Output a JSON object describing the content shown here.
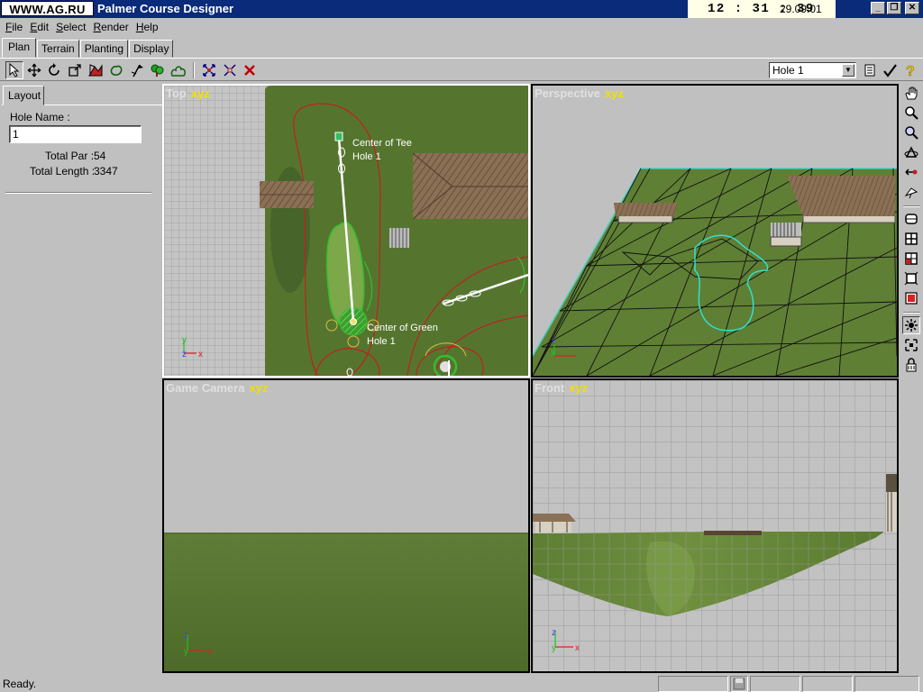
{
  "title_bar": {
    "logo": "WWW.AG.RU",
    "app_title": "Palmer Course Designer",
    "clock_time": "12 : 31 : 39",
    "clock_date": "29.09.01",
    "minimize": "_",
    "maximize": "❐",
    "close": "✕"
  },
  "menu": [
    "File",
    "Edit",
    "Select",
    "Render",
    "Help"
  ],
  "tabs": [
    "Plan",
    "Terrain",
    "Planting",
    "Display"
  ],
  "toolbar": {
    "hole_select": "Hole 1",
    "icons": [
      "select-arrow-icon",
      "move-icon",
      "rotate-icon",
      "scale-icon",
      "hazard-tool-icon",
      "green-tool-icon",
      "pin-tool-icon",
      "tree-tool-icon",
      "shrub-tool-icon",
      "grid-icon-1",
      "grid-icon-2",
      "delete-icon",
      "notes-icon",
      "check-icon",
      "help-icon"
    ]
  },
  "left_panel": {
    "tab": "Layout",
    "hole_name_label": "Hole Name :",
    "hole_name_value": "1",
    "total_par_label": "Total Par :",
    "total_par_value": "54",
    "total_length_label": "Total Length :",
    "total_length_value": "3347"
  },
  "viewports": {
    "top": {
      "name": "Top",
      "axes": "xyz",
      "tee_label_1": "Center of Tee",
      "tee_label_2": "Hole 1",
      "green_label_1": "Center of Green",
      "green_label_2": "Hole 1"
    },
    "perspective": {
      "name": "Perspective",
      "axes": "xyz"
    },
    "camera": {
      "name": "Game Camera",
      "axes": "xyz"
    },
    "front": {
      "name": "Front",
      "axes": "xyz"
    }
  },
  "right_tools": [
    "hand-pan-icon",
    "zoom-icon",
    "zoom-extents-icon",
    "orbit-icon",
    "dolly-icon",
    "fly-icon",
    "view-single-icon",
    "view-quad-icon",
    "view-layout-icon",
    "maximize-view-icon",
    "render-icon",
    "light-icon",
    "snap-icon",
    "lock-icon"
  ],
  "status": {
    "text": "Ready."
  },
  "colors": {
    "title_bg": "#0a2a7a",
    "grass": "#5a7a34",
    "window_bg": "#c0c0c0"
  }
}
